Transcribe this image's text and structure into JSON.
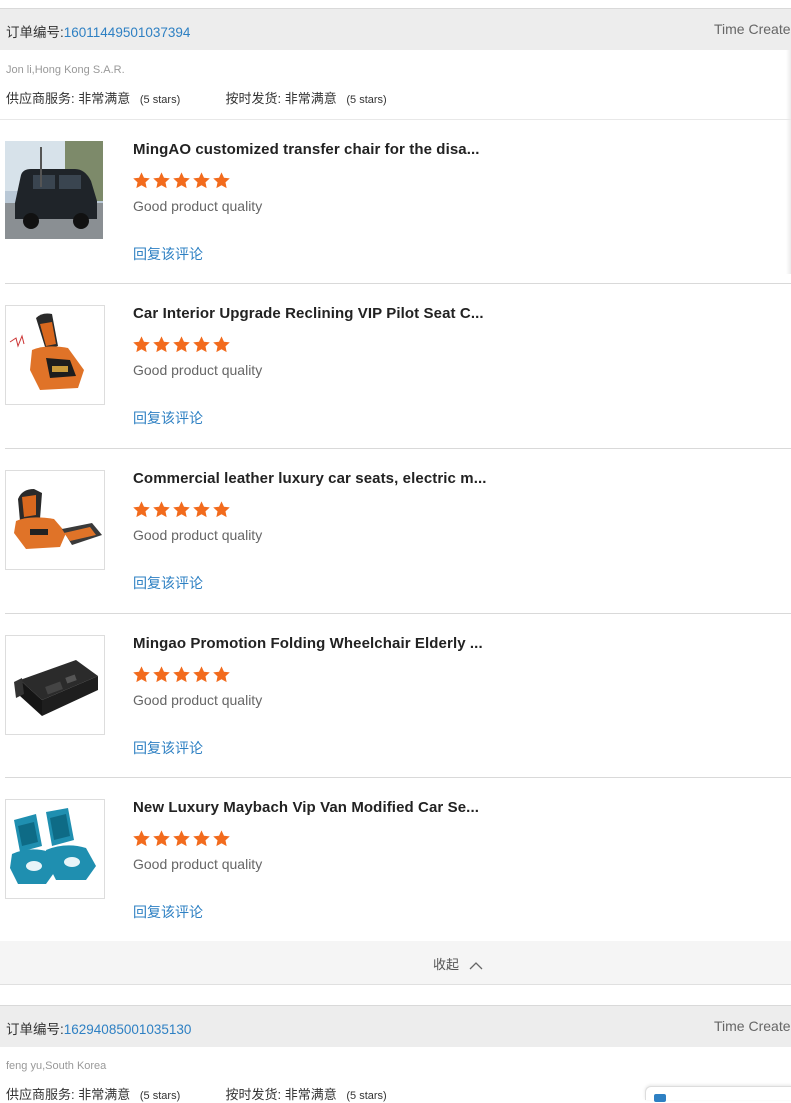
{
  "orders": [
    {
      "label": "订单编号:",
      "number": "16011449501037394",
      "time_label": "Time Created",
      "buyer": "Jon li,Hong Kong S.A.R.",
      "supplier_service": {
        "label": "供应商服务:",
        "value": "非常满意",
        "stars": "(5 stars)"
      },
      "on_time": {
        "label": "按时发货:",
        "value": "非常满意",
        "stars": "(5 stars)"
      },
      "items": [
        {
          "title": "MingAO customized transfer chair for the disa...",
          "rating": 5,
          "comment": "Good product quality",
          "reply": "回复该评论"
        },
        {
          "title": "Car Interior Upgrade Reclining VIP Pilot Seat C...",
          "rating": 5,
          "comment": "Good product quality",
          "reply": "回复该评论"
        },
        {
          "title": "Commercial leather luxury car seats, electric m...",
          "rating": 5,
          "comment": "Good product quality",
          "reply": "回复该评论"
        },
        {
          "title": "Mingao Promotion Folding Wheelchair Elderly ...",
          "rating": 5,
          "comment": "Good product quality",
          "reply": "回复该评论"
        },
        {
          "title": "New Luxury Maybach Vip Van Modified Car Se...",
          "rating": 5,
          "comment": "Good product quality",
          "reply": "回复该评论"
        }
      ],
      "collapse_label": "收起"
    },
    {
      "label": "订单编号:",
      "number": "16294085001035130",
      "time_label": "Time Created",
      "buyer": "feng yu,South Korea",
      "supplier_service": {
        "label": "供应商服务:",
        "value": "非常满意",
        "stars": "(5 stars)"
      },
      "on_time": {
        "label": "按时发货:",
        "value": "非常满意",
        "stars": "(5 stars)"
      }
    }
  ],
  "colors": {
    "star": "#f26b1d",
    "link": "#2e80c3",
    "header_bg": "#ededed"
  }
}
